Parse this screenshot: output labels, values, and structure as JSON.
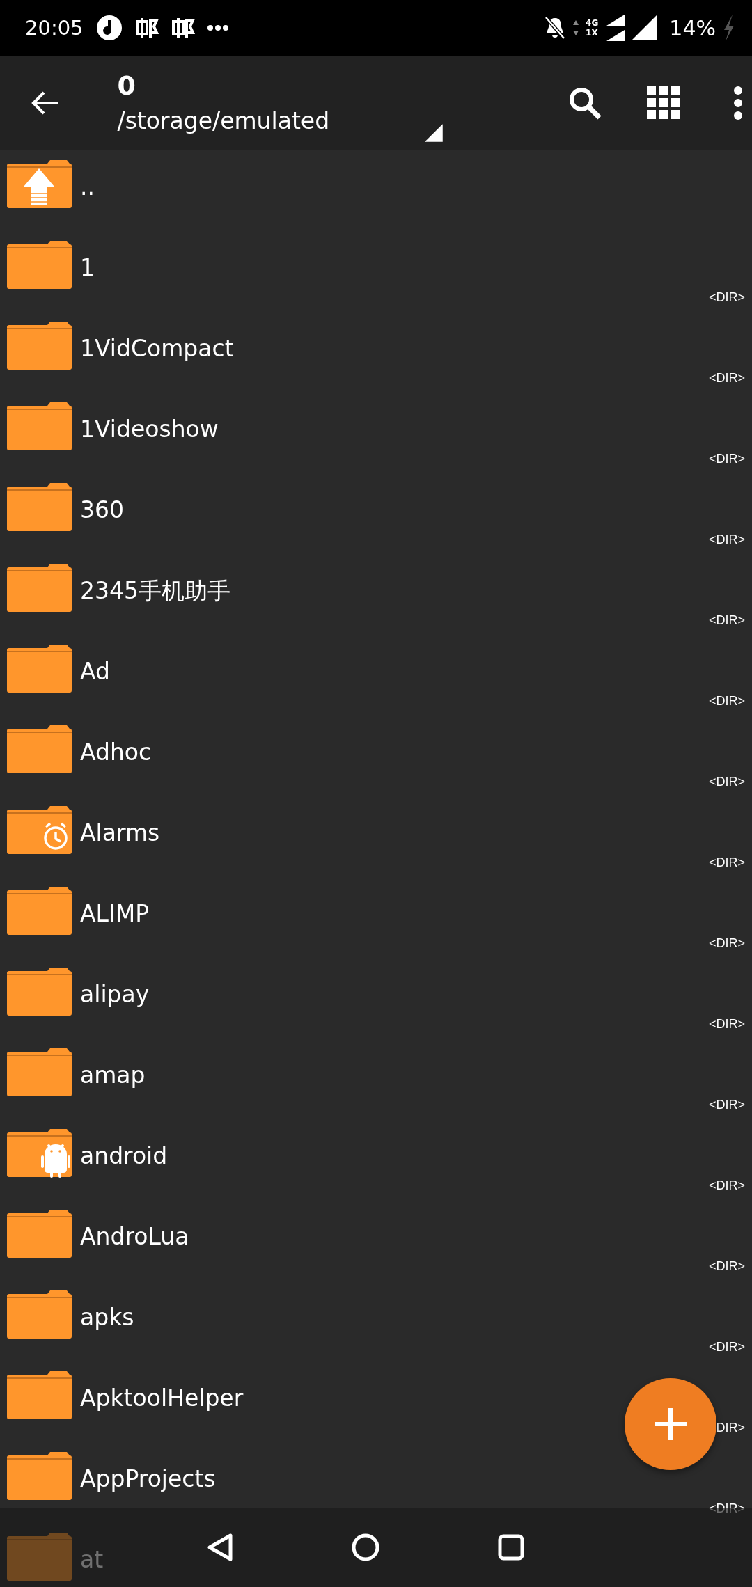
{
  "status_bar": {
    "time": "20:05",
    "network_top": "4G",
    "network_bottom": "1X",
    "battery": "14%"
  },
  "toolbar": {
    "title": "0",
    "path": "/storage/emulated"
  },
  "files": [
    {
      "name": "..",
      "kind": "up"
    },
    {
      "name": "1",
      "kind": "folder",
      "type": "<DIR>"
    },
    {
      "name": "1VidCompact",
      "kind": "folder",
      "type": "<DIR>"
    },
    {
      "name": "1Videoshow",
      "kind": "folder",
      "type": "<DIR>"
    },
    {
      "name": "360",
      "kind": "folder",
      "type": "<DIR>"
    },
    {
      "name": "2345手机助手",
      "kind": "folder",
      "type": "<DIR>"
    },
    {
      "name": "Ad",
      "kind": "folder",
      "type": "<DIR>"
    },
    {
      "name": "Adhoc",
      "kind": "folder",
      "type": "<DIR>"
    },
    {
      "name": "Alarms",
      "kind": "alarm",
      "type": "<DIR>"
    },
    {
      "name": "ALIMP",
      "kind": "folder",
      "type": "<DIR>"
    },
    {
      "name": "alipay",
      "kind": "folder",
      "type": "<DIR>"
    },
    {
      "name": "amap",
      "kind": "folder",
      "type": "<DIR>"
    },
    {
      "name": "android",
      "kind": "android",
      "type": "<DIR>"
    },
    {
      "name": "AndroLua",
      "kind": "folder",
      "type": "<DIR>"
    },
    {
      "name": "apks",
      "kind": "folder",
      "type": "<DIR>"
    },
    {
      "name": "ApktoolHelper",
      "kind": "folder",
      "type": "DIR>"
    },
    {
      "name": "AppProjects",
      "kind": "folder",
      "type": "<DIR>"
    },
    {
      "name": "at",
      "kind": "folder"
    }
  ]
}
